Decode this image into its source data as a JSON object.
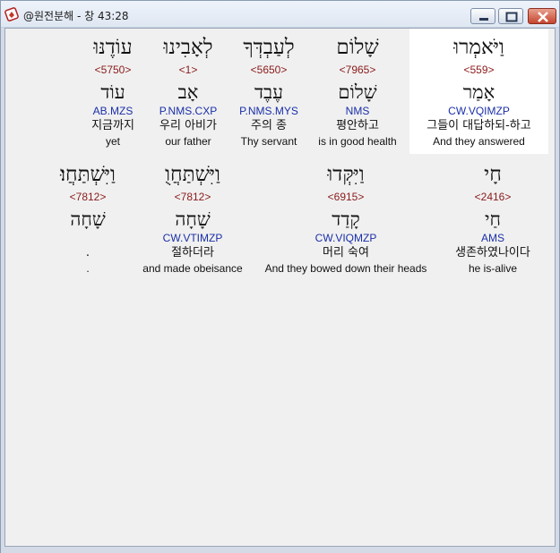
{
  "window": {
    "title": "@원전분해 - 창 43:28",
    "app_icon": "bible-app-icon",
    "controls": {
      "minimize": "minimize-icon",
      "maximize": "maximize-icon",
      "close": "close-icon"
    }
  },
  "rows": [
    {
      "words": [
        {
          "hebrew": "וַיֹּאמְרוּ",
          "strong": "<559>",
          "lemma": "אָמַר",
          "morph": "CW.VQIMZP",
          "korean": "그들이 대답하되-하고",
          "english": "And they answered",
          "selected": true
        },
        {
          "hebrew": "שָׁלוֹם",
          "strong": "<7965>",
          "lemma": "שָׁלוֹם",
          "morph": "NMS",
          "korean": "평안하고",
          "english": "is in good health",
          "selected": false
        },
        {
          "hebrew": "לְעַבְדְּךָ",
          "strong": "<5650>",
          "lemma": "עֶבֶד",
          "morph": "P.NMS.MYS",
          "korean": "주의 종",
          "english": "Thy servant",
          "selected": false
        },
        {
          "hebrew": "לְאָבִינוּ",
          "strong": "<1>",
          "lemma": "אָב",
          "morph": "P.NMS.CXP",
          "korean": "우리 아비가",
          "english": "our father",
          "selected": false
        },
        {
          "hebrew": "עוֹדֶנּוּ",
          "strong": "<5750>",
          "lemma": "עוֹד",
          "morph": "AB.MZS",
          "korean": "지금까지",
          "english": "yet",
          "selected": false
        }
      ]
    },
    {
      "words": [
        {
          "hebrew": "חָי",
          "strong": "<2416>",
          "lemma": "חַי",
          "morph": "AMS",
          "korean": "생존하였나이다",
          "english": "he is-alive",
          "selected": false
        },
        {
          "hebrew": "וַיִּקְּדוּ",
          "strong": "<6915>",
          "lemma": "קָדַד",
          "morph": "CW.VIQMZP",
          "korean": "머리 숙여",
          "english": "And they bowed down their heads",
          "selected": false
        },
        {
          "hebrew": "וַיִּשְׁתַּחֲוֻ",
          "strong": "<7812>",
          "lemma": "שָׁחָה",
          "morph": "CW.VTIMZP",
          "korean": "절하더라",
          "english": "and made obeisance",
          "selected": false
        },
        {
          "hebrew": "וַיִּשְׁתַּחֲוּ׃",
          "strong": "<7812>",
          "lemma": "שָׁחָה",
          "morph": "",
          "korean": ".",
          "english": ".",
          "selected": false
        }
      ]
    }
  ]
}
